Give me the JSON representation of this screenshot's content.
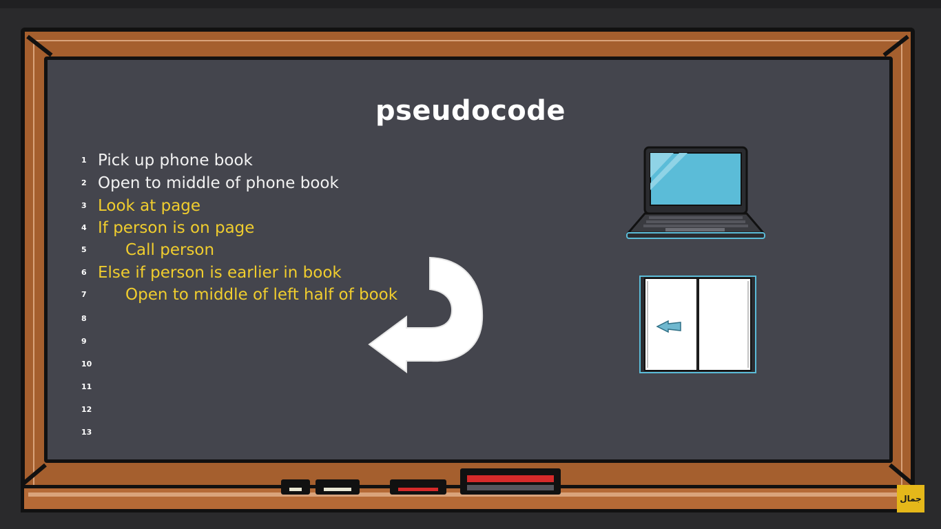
{
  "board": {
    "title": "pseudocode",
    "lines": [
      {
        "num": "1",
        "text": "Pick up phone book",
        "color": "#f2f2f2",
        "indent": 0
      },
      {
        "num": "2",
        "text": "Open to middle of phone book",
        "color": "#f2f2f2",
        "indent": 0
      },
      {
        "num": "3",
        "text": "Look at page",
        "color": "#f0cd2e",
        "indent": 0
      },
      {
        "num": "4",
        "text": "If person is on page",
        "color": "#f0cd2e",
        "indent": 0
      },
      {
        "num": "5",
        "text": "Call person",
        "color": "#f0cd2e",
        "indent": 1
      },
      {
        "num": "6",
        "text": "Else if person is earlier in book",
        "color": "#f0cd2e",
        "indent": 0
      },
      {
        "num": "7",
        "text": "Open to middle of left half of book",
        "color": "#f0cd2e",
        "indent": 1
      },
      {
        "num": "8",
        "text": "",
        "color": "#f2f2f2",
        "indent": 0
      },
      {
        "num": "9",
        "text": "",
        "color": "#f2f2f2",
        "indent": 0
      },
      {
        "num": "10",
        "text": "",
        "color": "#f2f2f2",
        "indent": 0
      },
      {
        "num": "11",
        "text": "",
        "color": "#f2f2f2",
        "indent": 0
      },
      {
        "num": "12",
        "text": "",
        "color": "#f2f2f2",
        "indent": 0
      },
      {
        "num": "13",
        "text": "",
        "color": "#f2f2f2",
        "indent": 0
      }
    ]
  },
  "icons": {
    "laptop": "laptop-icon",
    "book": "open-book-icon",
    "arrow": "curved-arrow-icon",
    "logo": "channel-logo-icon"
  },
  "logo_text": "جمال",
  "colors": {
    "board": "#44454d",
    "frame": "#a55f2e",
    "highlight": "#f0cd2e",
    "screen": "#5bbcd8"
  }
}
